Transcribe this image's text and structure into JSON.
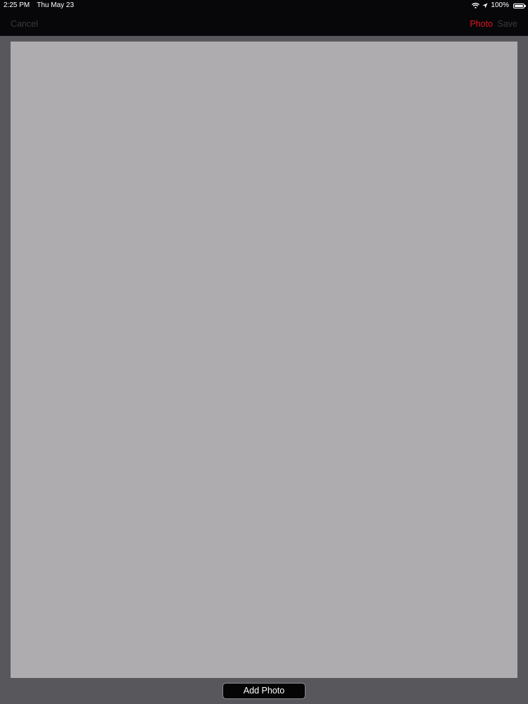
{
  "status_bar": {
    "time": "2:25 PM",
    "date": "Thu May 23",
    "battery_percent": "100%",
    "battery_level": 1.0,
    "icons": [
      "wifi-icon",
      "location-arrow-icon",
      "battery-icon"
    ]
  },
  "nav": {
    "cancel_label": "Cancel",
    "photo_label": "Photo",
    "save_label": "Save"
  },
  "toolbar": {
    "add_photo_label": "Add Photo"
  },
  "colors": {
    "accent": "#e0141e",
    "disabled_text": "#3a3a3d",
    "bar_background": "#070709",
    "page_background": "#58575b",
    "canvas": "#aeacaf"
  }
}
